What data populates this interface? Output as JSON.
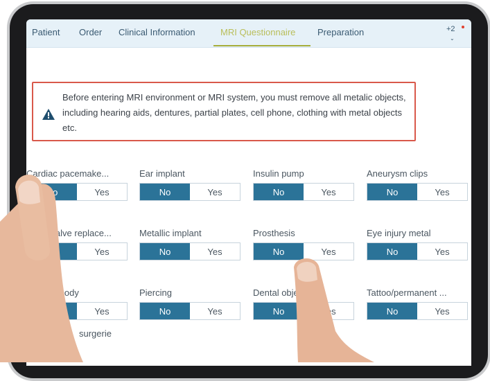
{
  "tabs": [
    {
      "label": "Patient"
    },
    {
      "label": "Order"
    },
    {
      "label": "Clinical Information"
    },
    {
      "label": "MRI Questionnaire",
      "active": true
    },
    {
      "label": "Preparation"
    }
  ],
  "more_tabs": "+2",
  "alert": {
    "icon": "warning-triangle-icon",
    "text": "Before entering MRI environment or MRI system, you must remove all metalic objects, including hearing aids, dentures, partial plates, cell phone, clothing with metal objects etc."
  },
  "questions": [
    {
      "label": "Cardiac pacemake...",
      "no": "No",
      "yes": "Yes",
      "selected": "No"
    },
    {
      "label": "Ear implant",
      "no": "No",
      "yes": "Yes",
      "selected": "No"
    },
    {
      "label": "Insulin pump",
      "no": "No",
      "yes": "Yes",
      "selected": "No"
    },
    {
      "label": "Aneurysm clips",
      "no": "No",
      "yes": "Yes",
      "selected": "No"
    },
    {
      "label": "Heart valve replace...",
      "no": "No",
      "yes": "Yes",
      "selected": "No"
    },
    {
      "label": "Metallic implant",
      "no": "No",
      "yes": "Yes",
      "selected": "No"
    },
    {
      "label": "Prosthesis",
      "no": "No",
      "yes": "Yes",
      "selected": "No"
    },
    {
      "label": "Eye injury metal",
      "no": "No",
      "yes": "Yes",
      "selected": "No"
    },
    {
      "label": "Foreign body",
      "no": "No",
      "yes": "Yes",
      "selected": "No"
    },
    {
      "label": "Piercing",
      "no": "No",
      "yes": "Yes",
      "selected": "No"
    },
    {
      "label": "Dental objects",
      "no": "No",
      "yes": "Yes",
      "selected": "No"
    },
    {
      "label": "Tattoo/permanent ...",
      "no": "No",
      "yes": "Yes",
      "selected": "No"
    }
  ],
  "partial_label": "surgerie",
  "colors": {
    "accent": "#2b7398",
    "active_tab": "#b9be5a",
    "alert_border": "#d9584a",
    "tabbar": "#e6f1f8"
  }
}
